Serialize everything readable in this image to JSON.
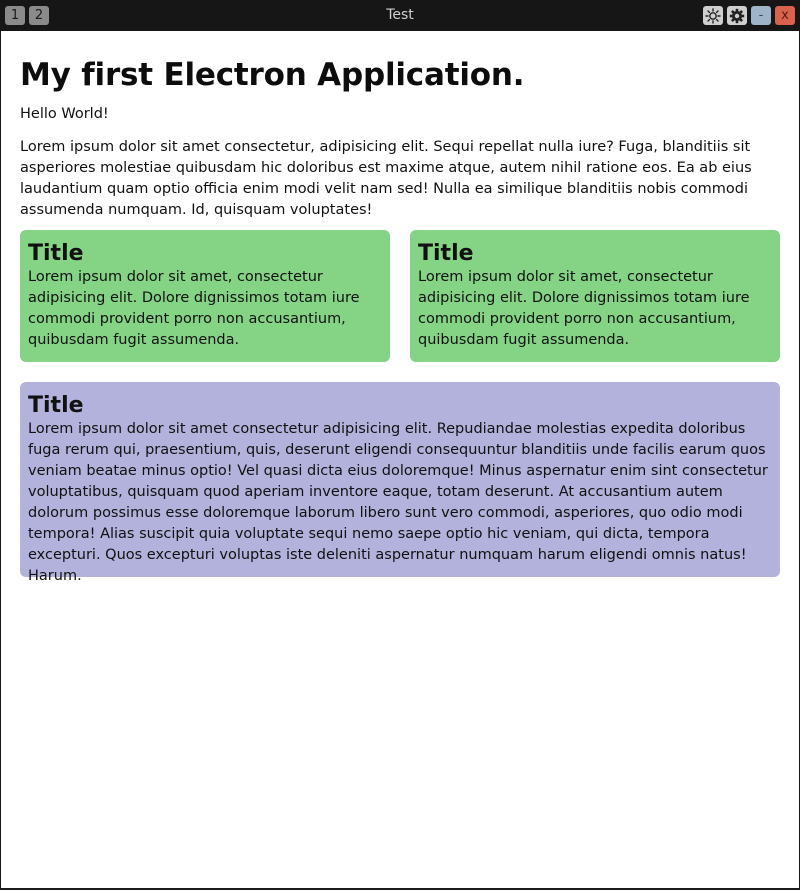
{
  "titlebar": {
    "workspaces": [
      "1",
      "2"
    ],
    "title": "Test",
    "minimize_label": "-",
    "close_label": "x",
    "icons": [
      "brightness-icon",
      "gear-icon"
    ]
  },
  "page": {
    "heading": "My first Electron Application.",
    "hello": "Hello World!",
    "intro": "Lorem ipsum dolor sit amet consectetur, adipisicing elit. Sequi repellat nulla iure? Fuga, blanditiis sit asperiores molestiae quibusdam hic doloribus est maxime atque, autem nihil ratione eos. Ea ab eius laudantium quam optio officia enim modi velit nam sed! Nulla ea similique blanditiis nobis commodi assumenda numquam. Id, quisquam voluptates!",
    "cards": [
      {
        "title": "Title",
        "text": "Lorem ipsum dolor sit amet, consectetur adipisicing elit. Dolore dignissimos totam iure commodi provident porro non accusantium, quibusdam fugit assumenda."
      },
      {
        "title": "Title",
        "text": "Lorem ipsum dolor sit amet, consectetur adipisicing elit. Dolore dignissimos totam iure commodi provident porro non accusantium, quibusdam fugit assumenda."
      },
      {
        "title": "Title",
        "text": "Lorem ipsum dolor sit amet consectetur adipisicing elit. Repudiandae molestias expedita doloribus fuga rerum qui, praesentium, quis, deserunt eligendi consequuntur blanditiis unde facilis earum quos veniam beatae minus optio! Vel quasi dicta eius doloremque! Minus aspernatur enim sint consectetur voluptatibus, quisquam quod aperiam inventore eaque, totam deserunt. At accusantium autem dolorum possimus esse doloremque laborum libero sunt vero commodi, asperiores, quo odio modi tempora! Alias suscipit quia voluptate sequi nemo saepe optio hic veniam, qui dicta, tempora excepturi. Quos excepturi voluptas iste deleniti aspernatur numquam harum eligendi omnis natus! Harum."
      }
    ]
  },
  "colors": {
    "green_card": "#85d486",
    "purple_card": "#b2b2dc",
    "titlebar": "#161616"
  }
}
